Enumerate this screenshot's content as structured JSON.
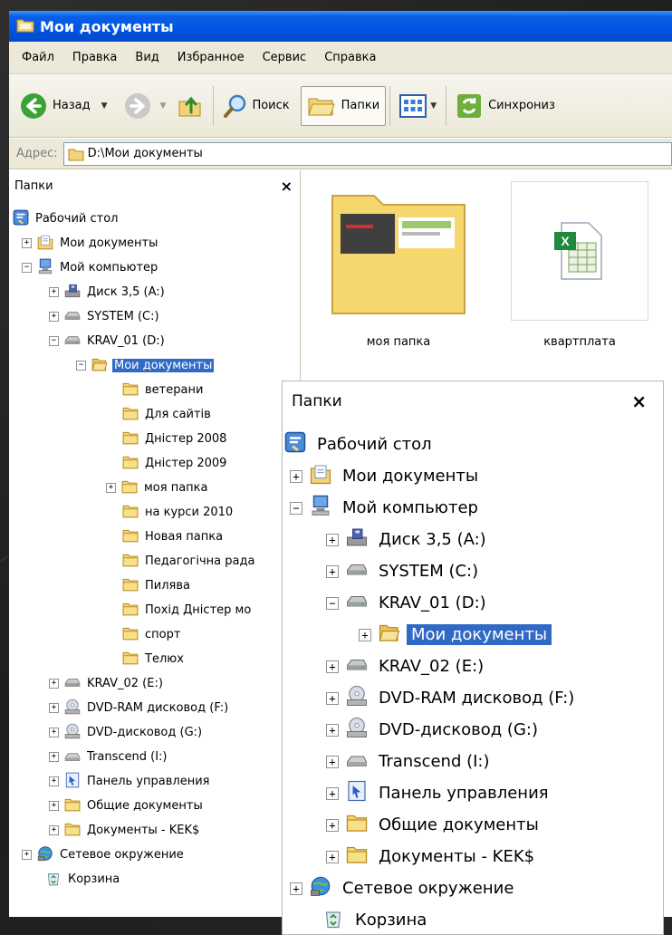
{
  "window": {
    "title": "Мои документы"
  },
  "menu": [
    "Файл",
    "Правка",
    "Вид",
    "Избранное",
    "Сервис",
    "Справка"
  ],
  "toolbar": {
    "back_label": "Назад",
    "search_label": "Поиск",
    "folders_label": "Папки",
    "sync_label": "Синхрониз"
  },
  "address": {
    "label": "Адрес:",
    "value": "D:\\Мои документы"
  },
  "folders_pane": {
    "title": "Папки",
    "close": "×",
    "tree": [
      {
        "label": "Рабочий стол",
        "icon": "desktop-icon",
        "expander": null
      },
      {
        "label": "Мои документы",
        "icon": "my-documents-icon",
        "expander": "+"
      },
      {
        "label": "Мой компьютер",
        "icon": "my-computer-icon",
        "expander": "−"
      },
      {
        "label": "Диск 3,5 (A:)",
        "icon": "floppy-drive-icon",
        "expander": "+"
      },
      {
        "label": "SYSTEM (C:)",
        "icon": "hard-drive-icon",
        "expander": "+"
      },
      {
        "label": "KRAV_01 (D:)",
        "icon": "hard-drive-icon",
        "expander": "−"
      },
      {
        "label": "Мои документы",
        "icon": "folder-open-icon",
        "expander": "−",
        "selected": true
      },
      {
        "label": "ветерани",
        "icon": "folder-icon",
        "expander": null
      },
      {
        "label": "Для сайтів",
        "icon": "folder-icon",
        "expander": null
      },
      {
        "label": "Дністер 2008",
        "icon": "folder-icon",
        "expander": null
      },
      {
        "label": "Дністер 2009",
        "icon": "folder-icon",
        "expander": null
      },
      {
        "label": "моя папка",
        "icon": "folder-icon",
        "expander": "+"
      },
      {
        "label": "на курси 2010",
        "icon": "folder-icon",
        "expander": null
      },
      {
        "label": "Новая папка",
        "icon": "folder-icon",
        "expander": null
      },
      {
        "label": "Педагогічна рада",
        "icon": "folder-icon",
        "expander": null
      },
      {
        "label": "Пилява",
        "icon": "folder-icon",
        "expander": null
      },
      {
        "label": "Похід Дністер мо",
        "icon": "folder-icon",
        "expander": null
      },
      {
        "label": "спорт",
        "icon": "folder-icon",
        "expander": null
      },
      {
        "label": "Телюх",
        "icon": "folder-icon",
        "expander": null
      },
      {
        "label": "KRAV_02 (E:)",
        "icon": "hard-drive-icon",
        "expander": "+"
      },
      {
        "label": "DVD-RAM дисковод (F:)",
        "icon": "dvd-drive-icon",
        "expander": "+"
      },
      {
        "label": "DVD-дисковод (G:)",
        "icon": "dvd-drive-icon",
        "expander": "+"
      },
      {
        "label": "Transcend (I:)",
        "icon": "removable-drive-icon",
        "expander": "+"
      },
      {
        "label": "Панель управления",
        "icon": "control-panel-icon",
        "expander": "+"
      },
      {
        "label": "Общие документы",
        "icon": "folder-icon",
        "expander": "+"
      },
      {
        "label": "Документы - KEK$",
        "icon": "folder-icon",
        "expander": "+"
      },
      {
        "label": "Сетевое окружение",
        "icon": "network-icon",
        "expander": "+"
      },
      {
        "label": "Корзина",
        "icon": "recycle-bin-icon",
        "expander": null
      }
    ]
  },
  "content": {
    "items": [
      {
        "label": "моя папка",
        "icon": "folder-thumbnail-icon"
      },
      {
        "label": "квартплата",
        "icon": "excel-file-icon"
      }
    ]
  },
  "zoom_pane": {
    "title": "Папки",
    "close": "×",
    "tree": [
      {
        "label": "Рабочий стол",
        "icon": "desktop-icon",
        "expander": null
      },
      {
        "label": "Мои документы",
        "icon": "my-documents-icon",
        "expander": "+"
      },
      {
        "label": "Мой компьютер",
        "icon": "my-computer-icon",
        "expander": "−"
      },
      {
        "label": "Диск 3,5 (A:)",
        "icon": "floppy-drive-icon",
        "expander": "+"
      },
      {
        "label": "SYSTEM (C:)",
        "icon": "hard-drive-icon",
        "expander": "+"
      },
      {
        "label": "KRAV_01 (D:)",
        "icon": "hard-drive-icon",
        "expander": "−"
      },
      {
        "label": "Мои документы",
        "icon": "folder-open-icon",
        "expander": "+",
        "selected": true
      },
      {
        "label": "KRAV_02 (E:)",
        "icon": "hard-drive-icon",
        "expander": "+"
      },
      {
        "label": "DVD-RAM дисковод (F:)",
        "icon": "dvd-drive-icon",
        "expander": "+"
      },
      {
        "label": "DVD-дисковод (G:)",
        "icon": "dvd-drive-icon",
        "expander": "+"
      },
      {
        "label": "Transcend (I:)",
        "icon": "removable-drive-icon",
        "expander": "+"
      },
      {
        "label": "Панель управления",
        "icon": "control-panel-icon",
        "expander": "+"
      },
      {
        "label": "Общие документы",
        "icon": "folder-icon",
        "expander": "+"
      },
      {
        "label": "Документы - KEK$",
        "icon": "folder-icon",
        "expander": "+"
      },
      {
        "label": "Сетевое окружение",
        "icon": "network-icon",
        "expander": "+"
      },
      {
        "label": "Корзина",
        "icon": "recycle-bin-icon",
        "expander": null
      }
    ]
  },
  "colors": {
    "titlebar": "#0054e3",
    "selection": "#316ac5",
    "chrome": "#ece9d8",
    "folder": "#f5d76e"
  }
}
